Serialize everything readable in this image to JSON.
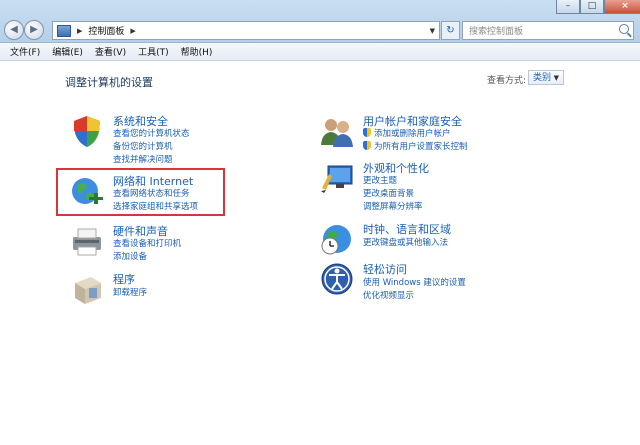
{
  "address": {
    "crumb": "控制面板",
    "search_placeholder": "搜索控制面板"
  },
  "menu": [
    "文件(F)",
    "编辑(E)",
    "查看(V)",
    "工具(T)",
    "帮助(H)"
  ],
  "main": {
    "heading": "调整计算机的设置",
    "view_by_label": "查看方式:",
    "view_by_value": "类别"
  },
  "categories": {
    "security": {
      "title": "系统和安全",
      "links": [
        "查看您的计算机状态",
        "备份您的计算机",
        "查找并解决问题"
      ]
    },
    "network": {
      "title": "网络和 Internet",
      "links": [
        "查看网络状态和任务",
        "选择家庭组和共享选项"
      ]
    },
    "hardware": {
      "title": "硬件和声音",
      "links": [
        "查看设备和打印机",
        "添加设备"
      ]
    },
    "programs": {
      "title": "程序",
      "links": [
        "卸载程序"
      ]
    },
    "users": {
      "title": "用户帐户和家庭安全",
      "links": [
        "添加或删除用户帐户",
        "为所有用户设置家长控制"
      ]
    },
    "appearance": {
      "title": "外观和个性化",
      "links": [
        "更改主题",
        "更改桌面背景",
        "调整屏幕分辨率"
      ]
    },
    "clock": {
      "title": "时钟、语言和区域",
      "links": [
        "更改键盘或其他输入法"
      ]
    },
    "ease": {
      "title": "轻松访问",
      "links": [
        "使用 Windows 建议的设置",
        "优化视频显示"
      ]
    }
  },
  "colors": {
    "link": "#1a5fb4",
    "highlight": "#d9343d"
  }
}
